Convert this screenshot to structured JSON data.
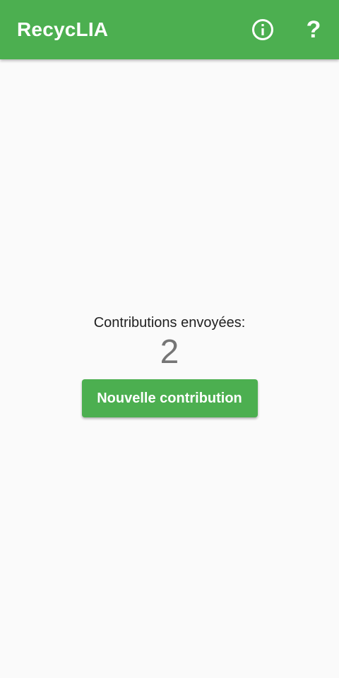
{
  "appbar": {
    "title": "RecycLIA",
    "info_icon": "info-circle-icon",
    "help_icon": "question-mark-icon",
    "help_glyph": "?",
    "color": "#4caf50"
  },
  "main": {
    "contributions_label": "Contributions envoyées:",
    "contributions_count": "2",
    "new_contribution_label": "Nouvelle contribution"
  }
}
